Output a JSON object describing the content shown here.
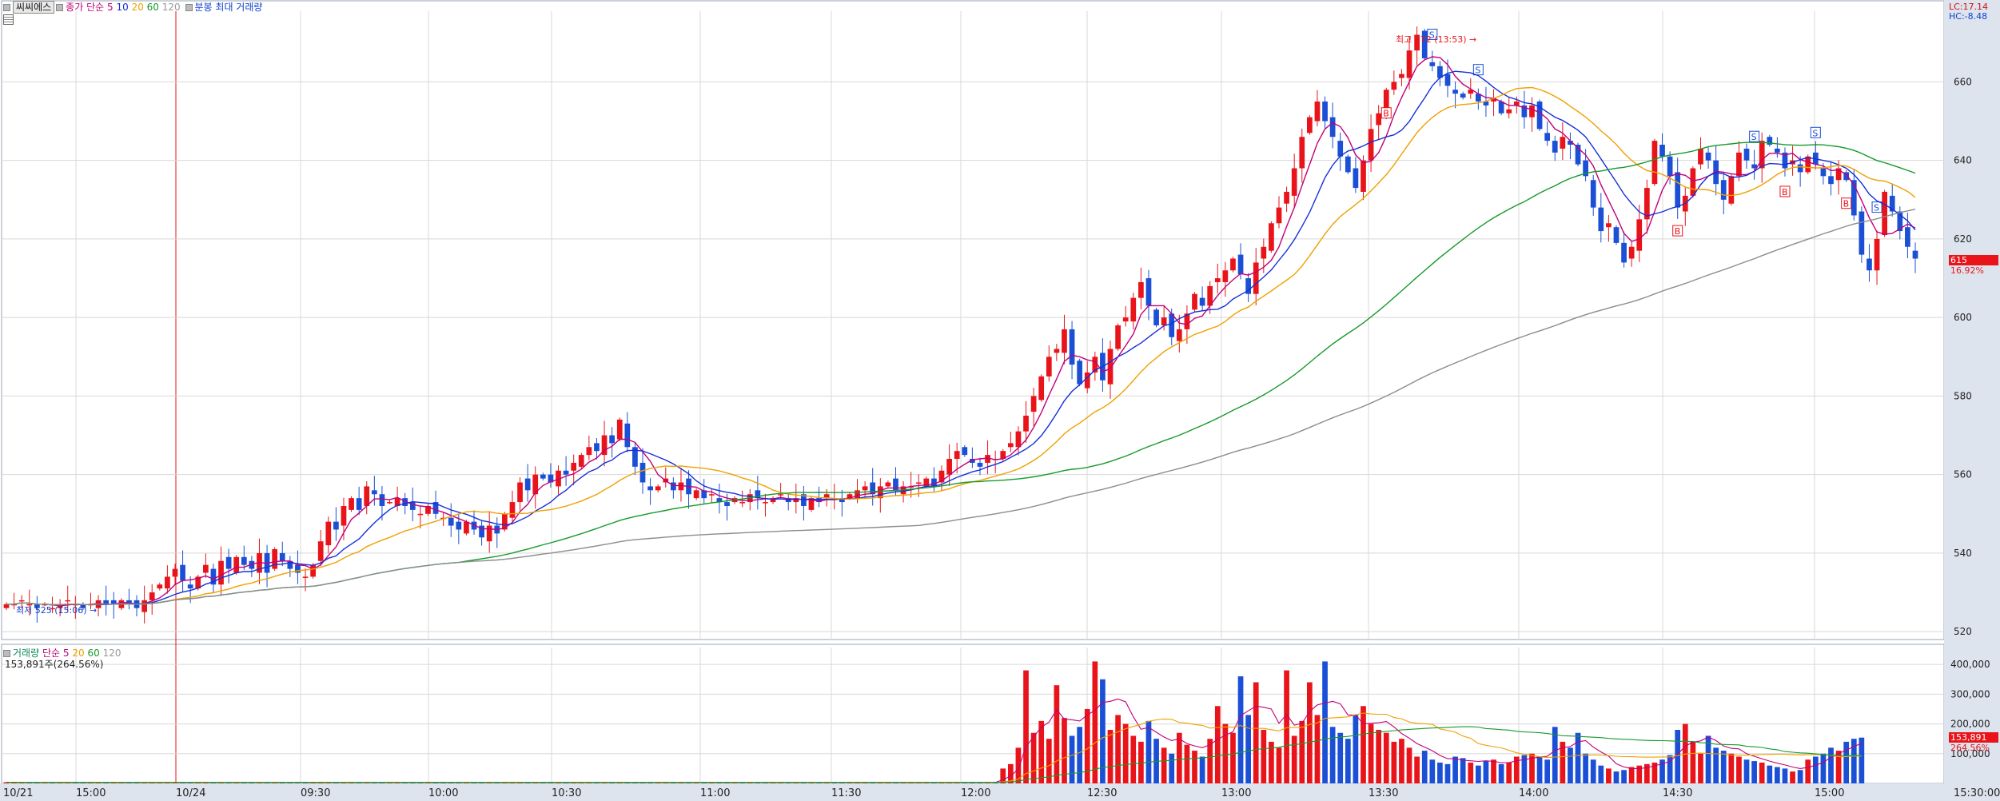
{
  "header": {
    "stock_name": "씨씨에스",
    "price_ma_label": "종가 단순",
    "ma_periods": [
      "5",
      "10",
      "20",
      "60",
      "120"
    ],
    "candle_label": "분봉 최대 거래량",
    "volume_label": "거래량",
    "volume_ma_label": "단순",
    "volume_ma_periods": [
      "5",
      "20",
      "60",
      "120"
    ],
    "volume_value": "153,891주(264.56%)"
  },
  "right_info": {
    "lc": "LC:17.14",
    "hc": "HC:-8.48"
  },
  "current": {
    "price_label": "615",
    "change_label": "16.92%",
    "volume_label": "153,891",
    "volume_ratio_label": "264.56%"
  },
  "colors": {
    "up": "#e8141a",
    "down": "#1a4fd6",
    "ma5": "#c0007a",
    "ma10": "#1530d8",
    "ma20": "#f0a000",
    "ma60": "#169a2a",
    "ma120": "#8c8c8c",
    "grid": "#d8d8d8",
    "axis_bg": "#dde4ee"
  },
  "chart_data": {
    "type": "candlestick",
    "price_axis": {
      "ticks": [
        520,
        540,
        560,
        580,
        600,
        620,
        640,
        660
      ],
      "ylim": [
        518,
        678
      ]
    },
    "volume_axis": {
      "ticks": [
        100000,
        200000,
        300000,
        400000
      ],
      "labels": [
        "100,000",
        "200,000",
        "300,000",
        "400,000"
      ],
      "ylim": [
        0,
        430000
      ]
    },
    "time_axis": [
      "10/21",
      "15:00",
      "10/24",
      "09:30",
      "10:00",
      "10:30",
      "11:00",
      "11:30",
      "12:00",
      "12:30",
      "13:00",
      "13:30",
      "14:00",
      "14:30",
      "15:00",
      "15:30:00"
    ],
    "annotations": {
      "high": "최고 672 (13:53)",
      "low": "최저 525 (15:06)"
    },
    "signals": [
      "S",
      "S",
      "S",
      "S",
      "S",
      "B",
      "B",
      "B",
      "B"
    ],
    "close": [
      527,
      527,
      528,
      527,
      526,
      527,
      526,
      527,
      528,
      527,
      526,
      527,
      528,
      527,
      527,
      528,
      527,
      526,
      528,
      530,
      532,
      534,
      536,
      533,
      531,
      534,
      537,
      532,
      538,
      536,
      539,
      537,
      536,
      540,
      535,
      541,
      538,
      536,
      535,
      534,
      537,
      543,
      548,
      546,
      552,
      554,
      551,
      557,
      555,
      552,
      553,
      554,
      552,
      551,
      550,
      552,
      550,
      549,
      547,
      546,
      548,
      546,
      544,
      547,
      545,
      550,
      553,
      558,
      556,
      560,
      559,
      558,
      561,
      560,
      563,
      565,
      567,
      566,
      570,
      568,
      574,
      567,
      562,
      558,
      556,
      557,
      559,
      556,
      558,
      555,
      556,
      554,
      555,
      553,
      552,
      554,
      553,
      555,
      554,
      553,
      554,
      555,
      553,
      554,
      552,
      554,
      553,
      555,
      554,
      553,
      555,
      556,
      557,
      555,
      557,
      558,
      556,
      557,
      557,
      558,
      559,
      557,
      561,
      564,
      566,
      565,
      563,
      562,
      565,
      564,
      566,
      568,
      571,
      575,
      580,
      585,
      590,
      592,
      597,
      588,
      583,
      586,
      590,
      584,
      592,
      598,
      600,
      605,
      609,
      603,
      598,
      600,
      595,
      597,
      601,
      606,
      603,
      608,
      610,
      612,
      615,
      611,
      606,
      614,
      618,
      624,
      628,
      632,
      638,
      646,
      651,
      655,
      650,
      646,
      641,
      637,
      633,
      640,
      648,
      652,
      658,
      660,
      662,
      668,
      672,
      666,
      664,
      661,
      659,
      657,
      656,
      658,
      655,
      654,
      656,
      652,
      653,
      655,
      651,
      654,
      648,
      645,
      642,
      646,
      644,
      639,
      636,
      628,
      622,
      624,
      619,
      614,
      618,
      625,
      633,
      645,
      641,
      636,
      628,
      631,
      638,
      643,
      640,
      634,
      630,
      636,
      642,
      640,
      638,
      645,
      644,
      642,
      638,
      640,
      637,
      641,
      639,
      636,
      634,
      638,
      635,
      626,
      616,
      612,
      620,
      632,
      627,
      622,
      618,
      615
    ],
    "volume": [
      4000,
      3000,
      3000,
      3000,
      3000,
      4000,
      3000,
      3000,
      3000,
      3000,
      4000,
      3000,
      3000,
      3000,
      3000,
      4000,
      3000,
      3000,
      3000,
      3000,
      4000,
      3000,
      3000,
      3000,
      3000,
      4000,
      3000,
      3000,
      3000,
      3000,
      4000,
      3000,
      3000,
      3000,
      3000,
      4000,
      3000,
      3000,
      3000,
      3000,
      4000,
      3000,
      3000,
      3000,
      3000,
      4000,
      3000,
      3000,
      3000,
      3000,
      4000,
      3000,
      3000,
      3000,
      3000,
      4000,
      3000,
      3000,
      3000,
      3000,
      4000,
      3000,
      3000,
      3000,
      3000,
      4000,
      3000,
      3000,
      3000,
      3000,
      4000,
      3000,
      3000,
      3000,
      3000,
      4000,
      3000,
      3000,
      3000,
      3000,
      4000,
      3000,
      3000,
      3000,
      3000,
      4000,
      3000,
      3000,
      3000,
      3000,
      4000,
      3000,
      3000,
      3000,
      3000,
      4000,
      3000,
      3000,
      3000,
      3000,
      4000,
      3000,
      3000,
      3000,
      3000,
      4000,
      3000,
      3000,
      3000,
      3000,
      4000,
      3000,
      3000,
      3000,
      3000,
      4000,
      3000,
      3000,
      3000,
      3000,
      4000,
      3000,
      3000,
      3000,
      3000,
      4000,
      3000,
      3000,
      3000,
      3000,
      50000,
      65000,
      120000,
      380000,
      170000,
      210000,
      150000,
      330000,
      220000,
      160000,
      190000,
      250000,
      410000,
      350000,
      180000,
      230000,
      200000,
      160000,
      140000,
      210000,
      150000,
      120000,
      100000,
      170000,
      130000,
      110000,
      90000,
      150000,
      260000,
      200000,
      170000,
      360000,
      230000,
      340000,
      180000,
      140000,
      120000,
      380000,
      160000,
      210000,
      340000,
      230000,
      410000,
      190000,
      170000,
      150000,
      230000,
      260000,
      200000,
      180000,
      170000,
      140000,
      150000,
      120000,
      90000,
      110000,
      80000,
      70000,
      65000,
      90000,
      85000,
      70000,
      60000,
      75000,
      80000,
      65000,
      70000,
      90000,
      95000,
      100000,
      90000,
      80000,
      190000,
      140000,
      120000,
      170000,
      100000,
      80000,
      60000,
      50000,
      40000,
      45000,
      55000,
      60000,
      65000,
      70000,
      80000,
      95000,
      180000,
      200000,
      140000,
      100000,
      160000,
      120000,
      110000,
      100000,
      90000,
      80000,
      75000,
      70000,
      60000,
      55000,
      50000,
      40000,
      45000,
      80000,
      90000,
      100000,
      120000,
      110000,
      140000,
      150000,
      154000
    ]
  }
}
